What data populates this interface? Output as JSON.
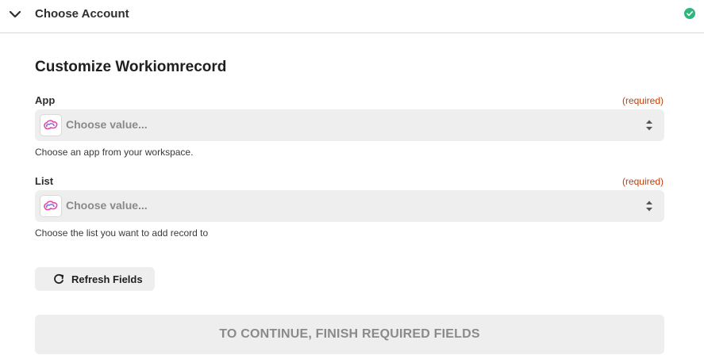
{
  "header": {
    "title": "Choose Account",
    "status_icon": "check-circle-icon",
    "status_color": "#2fb67c",
    "chevron_icon": "chevron-down-icon"
  },
  "section": {
    "title": "Customize Workiomrecord"
  },
  "fields": [
    {
      "label": "App",
      "required_text": "(required)",
      "placeholder": "Choose value...",
      "help": "Choose an app from your workspace."
    },
    {
      "label": "List",
      "required_text": "(required)",
      "placeholder": "Choose value...",
      "help": "Choose the list you want to add record to"
    }
  ],
  "refresh_button": {
    "label": "Refresh Fields",
    "icon": "refresh-icon"
  },
  "continue_button": {
    "label": "TO CONTINUE, FINISH REQUIRED FIELDS"
  },
  "colors": {
    "required": "#c2410c",
    "field_bg": "#eeeeee"
  }
}
